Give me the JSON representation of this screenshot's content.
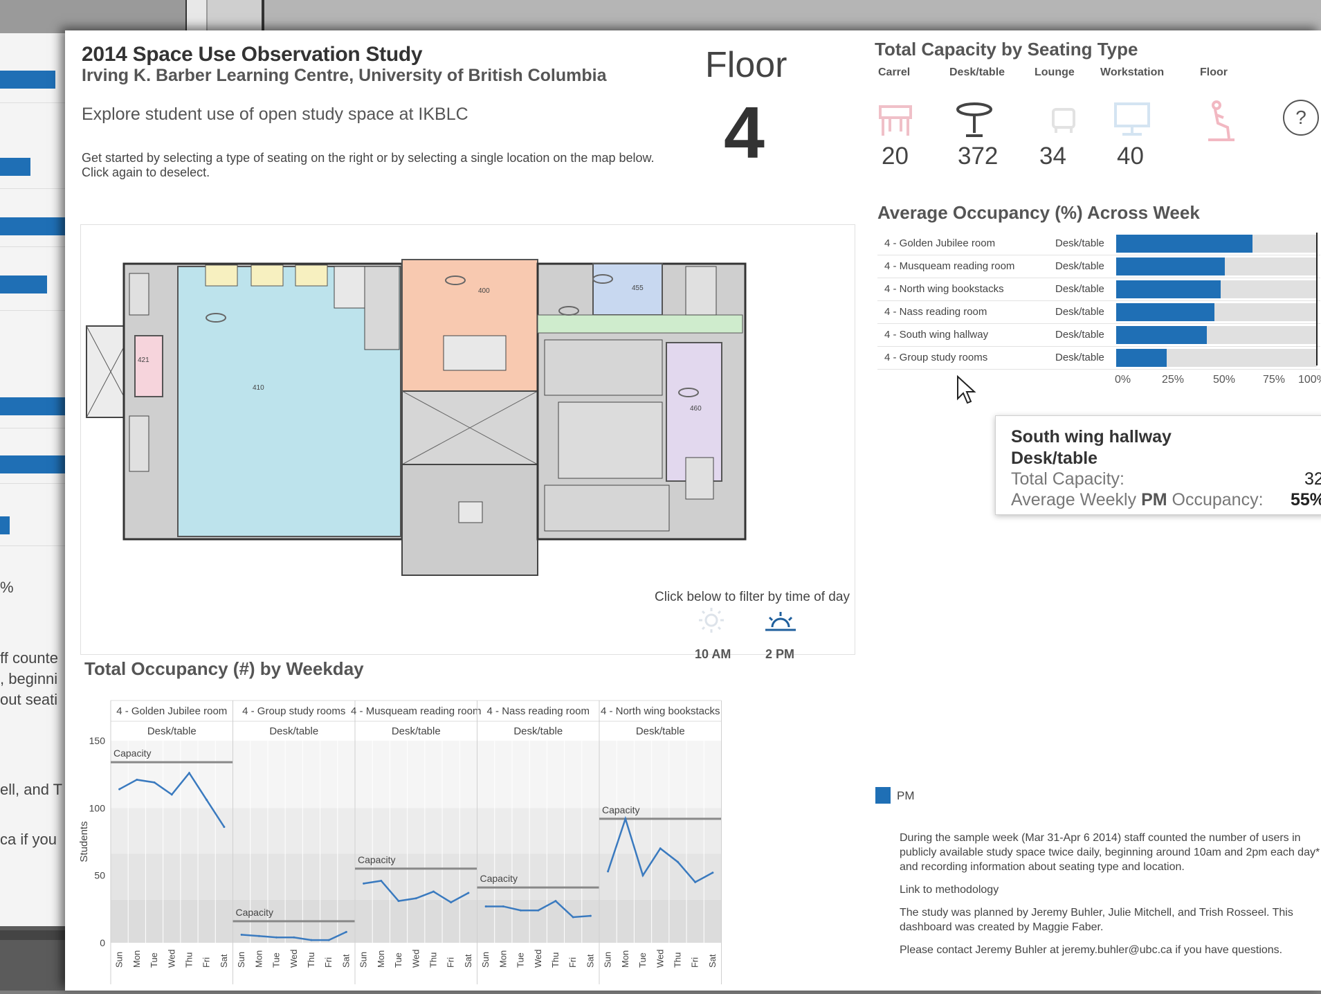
{
  "background": {
    "fragments": [
      "%",
      "ff counte",
      ", beginni",
      "out seati",
      "ell, and T",
      "ca if you"
    ]
  },
  "header": {
    "title": "2014 Space Use Observation Study",
    "subtitle": "Irving K. Barber Learning Centre, University of British Columbia",
    "tagline": "Explore student use of open study space at IKBLC",
    "intro_line1": "Get started by selecting a type of seating on the right or by selecting a single location on the map below.",
    "intro_line2": "Click again to deselect."
  },
  "floor": {
    "label": "Floor",
    "number": "4"
  },
  "capacity": {
    "title": "Total Capacity by Seating Type",
    "types": [
      {
        "label": "Carrel",
        "value": "20",
        "icon": "carrel-icon",
        "active": false
      },
      {
        "label": "Desk/table",
        "value": "372",
        "icon": "desk-table-icon",
        "active": true
      },
      {
        "label": "Lounge",
        "value": "34",
        "icon": "lounge-chair-icon",
        "active": false
      },
      {
        "label": "Workstation",
        "value": "40",
        "icon": "workstation-monitor-icon",
        "active": false
      },
      {
        "label": "Floor",
        "value": "",
        "icon": "floor-seating-icon",
        "active": false
      }
    ],
    "help": "?"
  },
  "occupancy": {
    "title": "Average Occupancy (%) Across Week",
    "rows": [
      {
        "location": "4 - Golden Jubilee room",
        "type": "Desk/table",
        "value": 68
      },
      {
        "location": "4 - Musqueam reading room",
        "type": "Desk/table",
        "value": 54
      },
      {
        "location": "4 - North wing bookstacks",
        "type": "Desk/table",
        "value": 52
      },
      {
        "location": "4 - Nass reading room",
        "type": "Desk/table",
        "value": 49
      },
      {
        "location": "4 - South wing hallway",
        "type": "Desk/table",
        "value": 45
      },
      {
        "location": "4 - Group study rooms",
        "type": "Desk/table",
        "value": 25
      }
    ],
    "axis": [
      "0%",
      "25%",
      "50%",
      "75%",
      "100%"
    ]
  },
  "tooltip": {
    "location": "South wing hallway",
    "type": "Desk/table",
    "capacity_label": "Total Capacity:",
    "capacity_value": "32",
    "occupancy_pre": "Average Weekly ",
    "occupancy_bold": "PM",
    "occupancy_post": " Occupancy:",
    "occupancy_value": "55%"
  },
  "map": {
    "room_labels": [
      "410",
      "400",
      "455",
      "421",
      "460"
    ],
    "filter_label": "Click below to filter by time of day",
    "times": [
      "10 AM",
      "2 PM"
    ],
    "time_icons": [
      "sun-morning-icon",
      "sun-afternoon-icon"
    ],
    "selected_time": "2 PM"
  },
  "weekday": {
    "title": "Total Occupancy (#) by Weekday",
    "ylabel": "Students",
    "yticks": [
      0,
      50,
      100,
      150
    ],
    "capacity_label": "Capacity",
    "days": [
      "Sun",
      "Mon",
      "Tue",
      "Wed",
      "Thu",
      "Fri",
      "Sat"
    ],
    "colors": {
      "line": "#3a7abf",
      "capacity": "#888888"
    },
    "panels": [
      {
        "location": "4 - Golden Jubilee room",
        "type": "Desk/table",
        "capacity": 134,
        "values": [
          114,
          121,
          119,
          110,
          126,
          106,
          86
        ]
      },
      {
        "location": "4 - Group study rooms",
        "type": "Desk/table",
        "capacity": 16,
        "values": [
          6,
          5,
          4,
          4,
          2,
          2,
          8
        ]
      },
      {
        "location": "4 - Musqueam reading room",
        "type": "Desk/table",
        "capacity": 55,
        "values": [
          44,
          46,
          31,
          33,
          38,
          30,
          37
        ]
      },
      {
        "location": "4 - Nass reading room",
        "type": "Desk/table",
        "capacity": 41,
        "values": [
          27,
          27,
          24,
          24,
          31,
          19,
          20
        ]
      },
      {
        "location": "4 - North wing bookstacks",
        "type": "Desk/table",
        "capacity": 92,
        "values": [
          53,
          92,
          50,
          70,
          60,
          45,
          52
        ]
      }
    ]
  },
  "chart_data": {
    "type": "line",
    "title": "Total Occupancy (#) by Weekday",
    "ylabel": "Students",
    "ylim": [
      0,
      150
    ],
    "x": [
      "Sun",
      "Mon",
      "Tue",
      "Wed",
      "Thu",
      "Fri",
      "Sat"
    ],
    "series": [
      {
        "name": "4 - Golden Jubilee room",
        "values": [
          114,
          121,
          119,
          110,
          126,
          106,
          86
        ]
      },
      {
        "name": "4 - Group study rooms",
        "values": [
          6,
          5,
          4,
          4,
          2,
          2,
          8
        ]
      },
      {
        "name": "4 - Musqueam reading room",
        "values": [
          44,
          46,
          31,
          33,
          38,
          30,
          37
        ]
      },
      {
        "name": "4 - Nass reading room",
        "values": [
          27,
          27,
          24,
          24,
          31,
          19,
          20
        ]
      },
      {
        "name": "4 - North wing bookstacks",
        "values": [
          53,
          92,
          50,
          70,
          60,
          45,
          52
        ]
      }
    ]
  },
  "legend": {
    "label": "PM"
  },
  "notes": {
    "p1": "During the sample week (Mar 31-Apr 6 2014) staff counted the number of users in publicly available study space twice daily, beginning around 10am and 2pm each day* and recording information about seating type and location.",
    "link": "Link to methodology",
    "p2": "The study was planned by Jeremy Buhler, Julie Mitchell, and Trish Rosseel. This dashboard was created by Maggie Faber.",
    "p3": "Please contact Jeremy Buhler at jeremy.buhler@ubc.ca if you have questions."
  }
}
